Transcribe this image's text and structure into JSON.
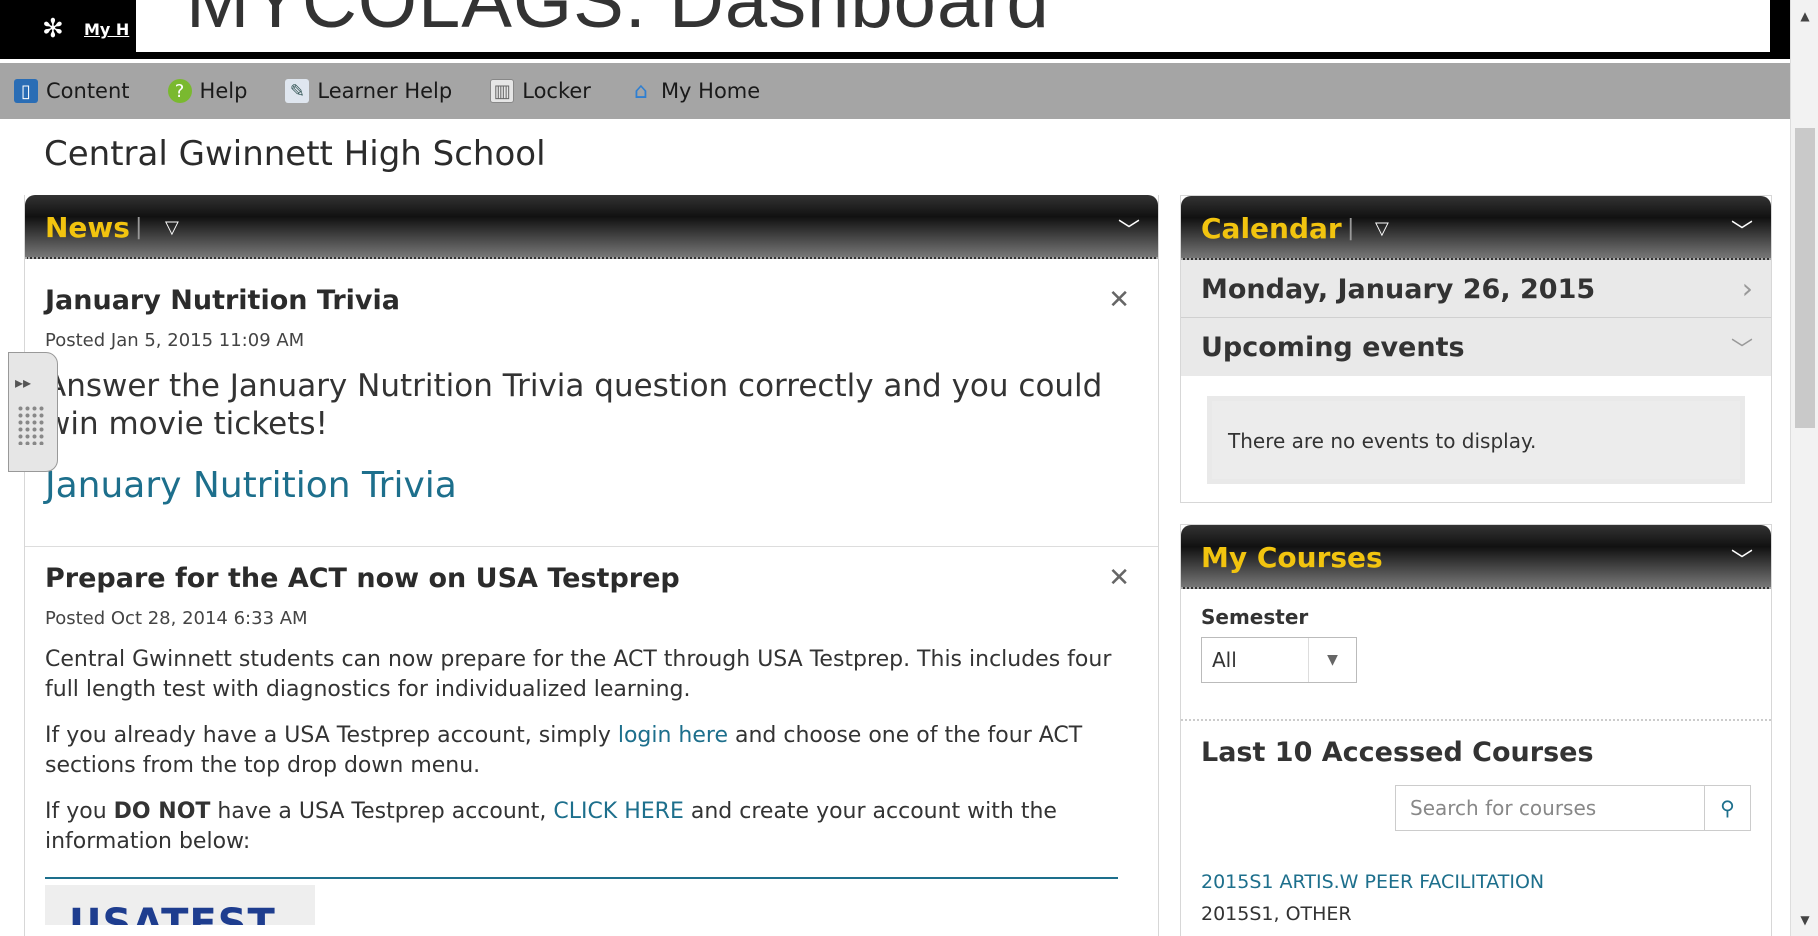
{
  "header": {
    "brand_link": "My H",
    "title": "MYCOLAGS: Dashboard"
  },
  "nav": [
    {
      "label": "Content",
      "icon": "book-icon"
    },
    {
      "label": "Help",
      "icon": "help-icon"
    },
    {
      "label": "Learner Help",
      "icon": "learner-help-icon"
    },
    {
      "label": "Locker",
      "icon": "locker-icon"
    },
    {
      "label": "My Home",
      "icon": "home-icon"
    }
  ],
  "school_name": "Central Gwinnett High School",
  "news": {
    "title": "News",
    "items": [
      {
        "title": "January Nutrition Trivia",
        "posted": "Posted Jan 5, 2015 11:09 AM",
        "body": "Answer the January Nutrition Trivia question correctly and you could win movie tickets!",
        "link": "January Nutrition Trivia"
      },
      {
        "title": "Prepare for the ACT now on USA Testprep",
        "posted": "Posted Oct 28, 2014 6:33 AM",
        "p1": "Central Gwinnett students can now prepare for the ACT through USA Testprep.  This includes four full length test with diagnostics for individualized learning.",
        "p2_before": "If you already have a USA Testprep account, simply ",
        "p2_link": "login here",
        "p2_after": " and choose one of the four ACT sections from the top drop down menu.",
        "p3_before": "If you ",
        "p3_bold": "DO NOT",
        "p3_mid": " have a USA Testprep account, ",
        "p3_link": "CLICK HERE",
        "p3_after": " and create your account with the information below:",
        "logo_text": "USATEST"
      }
    ]
  },
  "calendar": {
    "title": "Calendar",
    "date": "Monday, January 26, 2015",
    "upcoming": "Upcoming events",
    "no_events": "There are no events to display."
  },
  "courses": {
    "title": "My Courses",
    "semester_label": "Semester",
    "semester_value": "All",
    "last10": "Last 10 Accessed Courses",
    "search_placeholder": "Search for courses",
    "course_name": "2015S1 ARTIS.W PEER FACILITATION",
    "course_meta": "2015S1, OTHER"
  },
  "colors": {
    "accent_title": "#f2c40f",
    "link": "#1d6f8c",
    "navbar": "#a5a5a5"
  }
}
